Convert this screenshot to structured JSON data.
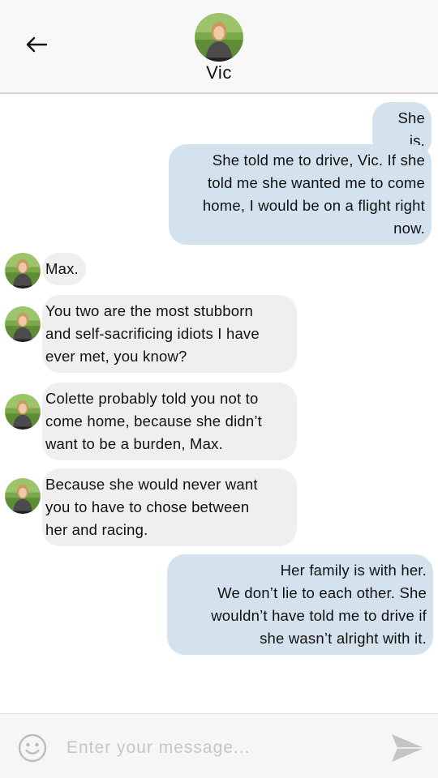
{
  "contact": {
    "name": "Vic",
    "avatar_icon": "contact-avatar-photo"
  },
  "header": {
    "back_icon": "back-arrow-icon"
  },
  "messages": [
    {
      "side": "sent",
      "text": "She is."
    },
    {
      "side": "sent",
      "lines": [
        "She told me to drive, Vic. If she",
        "told me she wanted me to come",
        "home, I would be on a flight right",
        "now."
      ]
    },
    {
      "side": "received",
      "text": "Max."
    },
    {
      "side": "received",
      "lines": [
        "You two are the most stubborn",
        "and self-sacrificing idiots I have",
        "ever met, you know?"
      ]
    },
    {
      "side": "received",
      "lines": [
        "Colette probably told you not to",
        "come home, because she didn’t",
        "want to be a burden, Max."
      ]
    },
    {
      "side": "received",
      "lines": [
        "Because she would never want",
        "you to have to chose between",
        "her and racing."
      ]
    },
    {
      "side": "sent",
      "lines": [
        "Her family is with her.",
        "We don’t lie to each other. She",
        "wouldn’t have told me to drive if",
        "she wasn’t alright with it."
      ]
    }
  ],
  "composer": {
    "placeholder": "Enter your message...",
    "value": "",
    "emoji_icon": "emoji-icon",
    "send_icon": "send-icon"
  },
  "colors": {
    "sent_bubble": "#d3e2ec",
    "received_bubble": "#efefef",
    "header_bg": "#f8f8f8",
    "placeholder": "#c6c6c6"
  }
}
